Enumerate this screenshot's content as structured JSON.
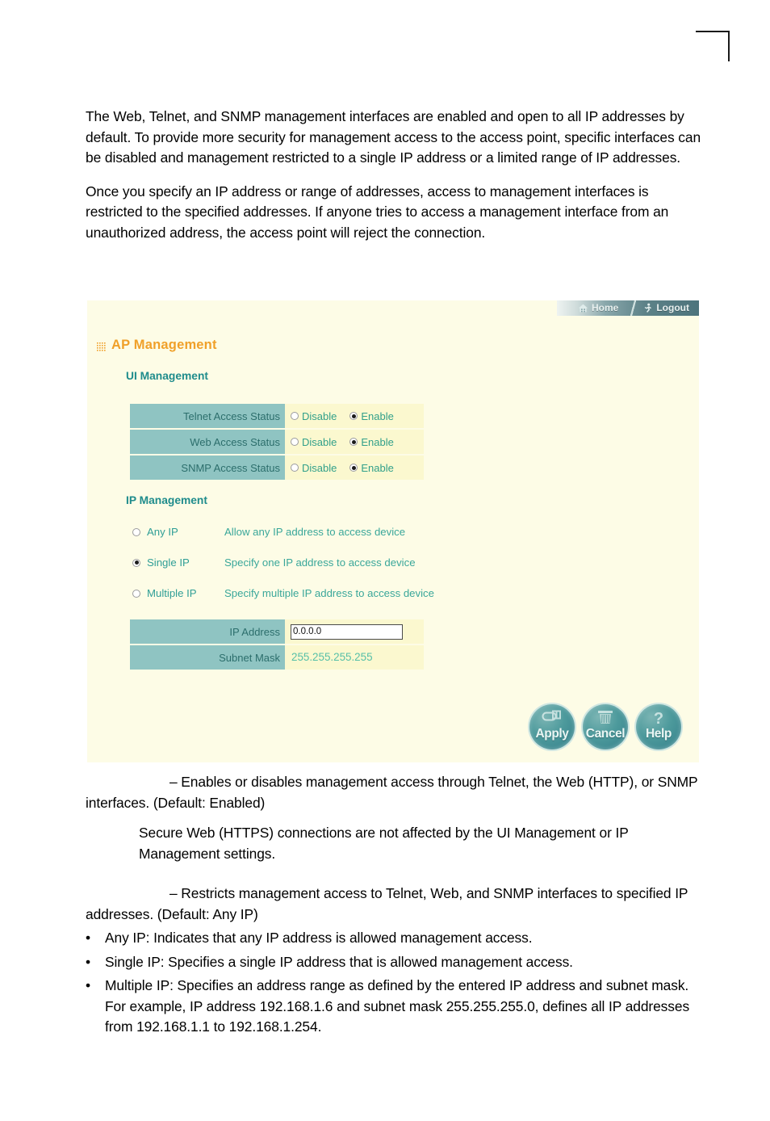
{
  "document": {
    "intro_paragraphs": [
      "The Web, Telnet, and SNMP management interfaces are enabled and open to all IP addresses by default. To provide more security for management access to the access point, specific interfaces can be disabled and management restricted to a single IP address or a limited range of IP addresses.",
      "Once you specify an IP address or range of addresses, access to management interfaces is restricted to the specified addresses. If anyone tries to access a management interface from an unauthorized address, the access point will reject the connection."
    ],
    "after_figure": {
      "ui_management_desc": "– Enables or disables management access through Telnet, the Web (HTTP), or SNMP interfaces. (Default: Enabled)",
      "note": "Secure Web (HTTPS) connections are not affected by the UI Management or IP Management settings.",
      "ip_management_desc": "– Restricts management access to Telnet, Web, and SNMP interfaces to specified IP addresses. (Default: Any IP)"
    },
    "bullets": [
      {
        "marker": "•",
        "text": "Any IP: Indicates that any IP address is allowed management access."
      },
      {
        "marker": "•",
        "text": "Single IP: Specifies a single IP address that is allowed management access."
      },
      {
        "marker": "•",
        "text": "Multiple IP: Specifies an address range as defined by the entered IP address and subnet mask. For example, IP address 192.168.1.6 and subnet mask 255.255.255.0, defines all IP addresses from 192.168.1.1 to 192.168.1.254."
      }
    ]
  },
  "figure": {
    "nav": {
      "home_label": "Home",
      "home_icon": "house-icon",
      "logout_label": "Logout",
      "logout_icon": "running-person-icon"
    },
    "page_title": "AP Management",
    "page_title_icon": "grid-dots-icon",
    "ui_management": {
      "heading": "UI Management",
      "radio_options": [
        "Disable",
        "Enable"
      ],
      "rows": [
        {
          "label": "Telnet Access Status",
          "selected": "Enable"
        },
        {
          "label": "Web Access Status",
          "selected": "Enable"
        },
        {
          "label": "SNMP Access Status",
          "selected": "Enable"
        }
      ]
    },
    "ip_management": {
      "heading": "IP Management",
      "options": [
        {
          "name": "Any IP",
          "description": "Allow any IP address to access device",
          "selected": false
        },
        {
          "name": "Single IP",
          "description": "Specify one IP address to access device",
          "selected": true
        },
        {
          "name": "Multiple IP",
          "description": "Specify multiple IP address to access device",
          "selected": false
        }
      ],
      "fields": [
        {
          "label": "IP Address",
          "value": "0.0.0.0",
          "editable": true
        },
        {
          "label": "Subnet Mask",
          "value": "255.255.255.255",
          "editable": false
        }
      ]
    },
    "buttons": [
      {
        "label": "Apply",
        "icon": "save-disk-icon"
      },
      {
        "label": "Cancel",
        "icon": "trash-can-icon"
      },
      {
        "label": "Help",
        "icon": "question-mark-icon"
      }
    ],
    "colors": {
      "panel_background": "#fdfce6",
      "label_cell": "#8fc4c2",
      "value_cell": "#fbf8cf",
      "title_orange": "#f0a029",
      "heading_teal": "#1f8c8c",
      "text_teal": "#32a08a",
      "button_teal": "#4d9a9c"
    }
  }
}
